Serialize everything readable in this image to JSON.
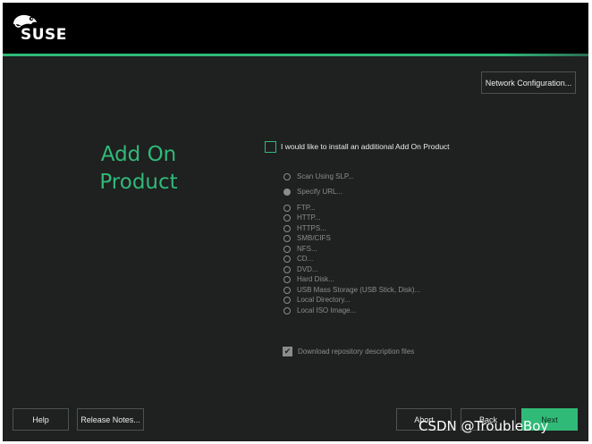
{
  "brand": {
    "logo_text": "SUSE"
  },
  "buttons": {
    "network_config": "Network Configuration...",
    "help": "Help",
    "release_notes": "Release Notes...",
    "abort": "Abort",
    "back": "Back",
    "next": "Next"
  },
  "heading": {
    "line1": "Add On",
    "line2": "Product"
  },
  "main_checkbox": {
    "label": "I would like to install an additional Add On Product",
    "checked": false
  },
  "options": [
    {
      "label": "Scan Using SLP...",
      "selected": false
    },
    {
      "label": "Specify URL...",
      "selected": true
    },
    {
      "label": "FTP...",
      "selected": false
    },
    {
      "label": "HTTP...",
      "selected": false
    },
    {
      "label": "HTTPS...",
      "selected": false
    },
    {
      "label": "SMB/CIFS",
      "selected": false
    },
    {
      "label": "NFS...",
      "selected": false
    },
    {
      "label": "CD...",
      "selected": false
    },
    {
      "label": "DVD...",
      "selected": false
    },
    {
      "label": "Hard Disk...",
      "selected": false
    },
    {
      "label": "USB Mass Storage (USB Stick, Disk)...",
      "selected": false
    },
    {
      "label": "Local Directory...",
      "selected": false
    },
    {
      "label": "Local ISO Image...",
      "selected": false
    }
  ],
  "download_checkbox": {
    "label": "Download repository description files",
    "checked": true
  },
  "watermark": "CSDN @TroubleBoy",
  "colors": {
    "accent": "#30ba78",
    "background": "#1f2020",
    "topbar": "#000000",
    "disabled": "#8a8d8b"
  }
}
